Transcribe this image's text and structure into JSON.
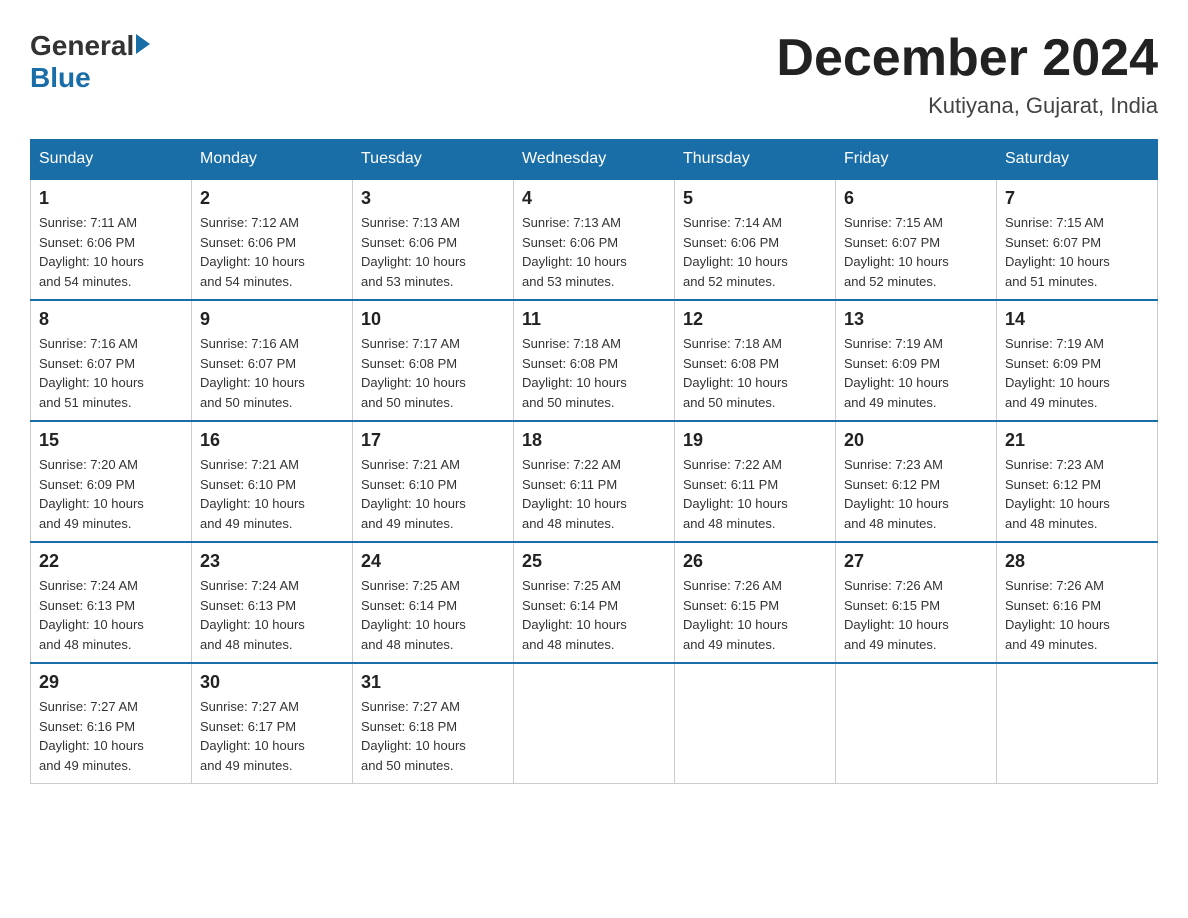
{
  "logo": {
    "general": "General",
    "blue": "Blue"
  },
  "title": "December 2024",
  "location": "Kutiyana, Gujarat, India",
  "days_header": [
    "Sunday",
    "Monday",
    "Tuesday",
    "Wednesday",
    "Thursday",
    "Friday",
    "Saturday"
  ],
  "weeks": [
    [
      {
        "day": "1",
        "sunrise": "7:11 AM",
        "sunset": "6:06 PM",
        "daylight": "10 hours and 54 minutes."
      },
      {
        "day": "2",
        "sunrise": "7:12 AM",
        "sunset": "6:06 PM",
        "daylight": "10 hours and 54 minutes."
      },
      {
        "day": "3",
        "sunrise": "7:13 AM",
        "sunset": "6:06 PM",
        "daylight": "10 hours and 53 minutes."
      },
      {
        "day": "4",
        "sunrise": "7:13 AM",
        "sunset": "6:06 PM",
        "daylight": "10 hours and 53 minutes."
      },
      {
        "day": "5",
        "sunrise": "7:14 AM",
        "sunset": "6:06 PM",
        "daylight": "10 hours and 52 minutes."
      },
      {
        "day": "6",
        "sunrise": "7:15 AM",
        "sunset": "6:07 PM",
        "daylight": "10 hours and 52 minutes."
      },
      {
        "day": "7",
        "sunrise": "7:15 AM",
        "sunset": "6:07 PM",
        "daylight": "10 hours and 51 minutes."
      }
    ],
    [
      {
        "day": "8",
        "sunrise": "7:16 AM",
        "sunset": "6:07 PM",
        "daylight": "10 hours and 51 minutes."
      },
      {
        "day": "9",
        "sunrise": "7:16 AM",
        "sunset": "6:07 PM",
        "daylight": "10 hours and 50 minutes."
      },
      {
        "day": "10",
        "sunrise": "7:17 AM",
        "sunset": "6:08 PM",
        "daylight": "10 hours and 50 minutes."
      },
      {
        "day": "11",
        "sunrise": "7:18 AM",
        "sunset": "6:08 PM",
        "daylight": "10 hours and 50 minutes."
      },
      {
        "day": "12",
        "sunrise": "7:18 AM",
        "sunset": "6:08 PM",
        "daylight": "10 hours and 50 minutes."
      },
      {
        "day": "13",
        "sunrise": "7:19 AM",
        "sunset": "6:09 PM",
        "daylight": "10 hours and 49 minutes."
      },
      {
        "day": "14",
        "sunrise": "7:19 AM",
        "sunset": "6:09 PM",
        "daylight": "10 hours and 49 minutes."
      }
    ],
    [
      {
        "day": "15",
        "sunrise": "7:20 AM",
        "sunset": "6:09 PM",
        "daylight": "10 hours and 49 minutes."
      },
      {
        "day": "16",
        "sunrise": "7:21 AM",
        "sunset": "6:10 PM",
        "daylight": "10 hours and 49 minutes."
      },
      {
        "day": "17",
        "sunrise": "7:21 AM",
        "sunset": "6:10 PM",
        "daylight": "10 hours and 49 minutes."
      },
      {
        "day": "18",
        "sunrise": "7:22 AM",
        "sunset": "6:11 PM",
        "daylight": "10 hours and 48 minutes."
      },
      {
        "day": "19",
        "sunrise": "7:22 AM",
        "sunset": "6:11 PM",
        "daylight": "10 hours and 48 minutes."
      },
      {
        "day": "20",
        "sunrise": "7:23 AM",
        "sunset": "6:12 PM",
        "daylight": "10 hours and 48 minutes."
      },
      {
        "day": "21",
        "sunrise": "7:23 AM",
        "sunset": "6:12 PM",
        "daylight": "10 hours and 48 minutes."
      }
    ],
    [
      {
        "day": "22",
        "sunrise": "7:24 AM",
        "sunset": "6:13 PM",
        "daylight": "10 hours and 48 minutes."
      },
      {
        "day": "23",
        "sunrise": "7:24 AM",
        "sunset": "6:13 PM",
        "daylight": "10 hours and 48 minutes."
      },
      {
        "day": "24",
        "sunrise": "7:25 AM",
        "sunset": "6:14 PM",
        "daylight": "10 hours and 48 minutes."
      },
      {
        "day": "25",
        "sunrise": "7:25 AM",
        "sunset": "6:14 PM",
        "daylight": "10 hours and 48 minutes."
      },
      {
        "day": "26",
        "sunrise": "7:26 AM",
        "sunset": "6:15 PM",
        "daylight": "10 hours and 49 minutes."
      },
      {
        "day": "27",
        "sunrise": "7:26 AM",
        "sunset": "6:15 PM",
        "daylight": "10 hours and 49 minutes."
      },
      {
        "day": "28",
        "sunrise": "7:26 AM",
        "sunset": "6:16 PM",
        "daylight": "10 hours and 49 minutes."
      }
    ],
    [
      {
        "day": "29",
        "sunrise": "7:27 AM",
        "sunset": "6:16 PM",
        "daylight": "10 hours and 49 minutes."
      },
      {
        "day": "30",
        "sunrise": "7:27 AM",
        "sunset": "6:17 PM",
        "daylight": "10 hours and 49 minutes."
      },
      {
        "day": "31",
        "sunrise": "7:27 AM",
        "sunset": "6:18 PM",
        "daylight": "10 hours and 50 minutes."
      },
      null,
      null,
      null,
      null
    ]
  ],
  "labels": {
    "sunrise": "Sunrise:",
    "sunset": "Sunset:",
    "daylight": "Daylight:"
  }
}
